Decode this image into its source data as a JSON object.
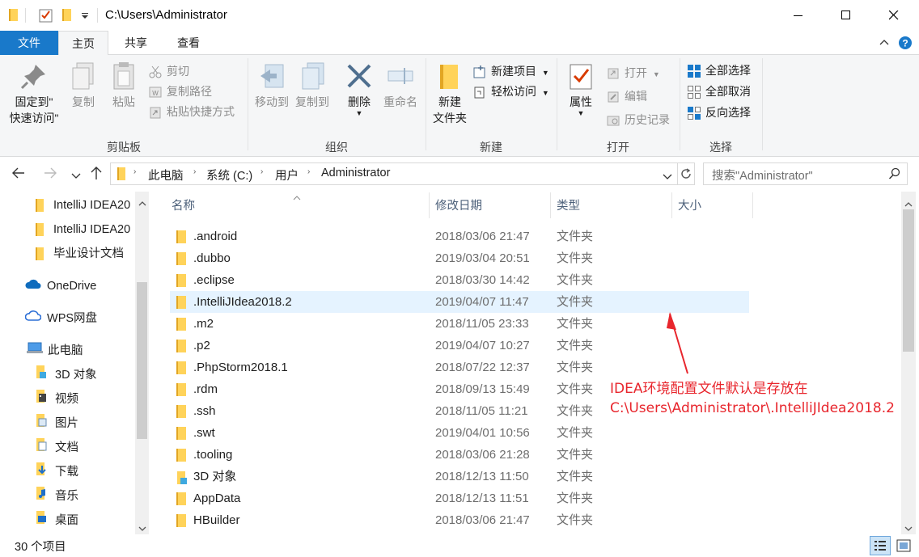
{
  "window": {
    "title": "C:\\Users\\Administrator",
    "minimize_glyph": "—",
    "maximize_glyph": "☐",
    "close_glyph": "✕"
  },
  "tabs": [
    {
      "label": "文件"
    },
    {
      "label": "主页"
    },
    {
      "label": "共享"
    },
    {
      "label": "查看"
    }
  ],
  "ribbon": {
    "clipboard": {
      "label": "剪贴板",
      "pin_line1": "固定到\"",
      "pin_line2": "快速访问\"",
      "copy": "复制",
      "paste": "粘贴",
      "cut": "剪切",
      "copy_path": "复制路径",
      "paste_shortcut": "粘贴快捷方式"
    },
    "organize": {
      "label": "组织",
      "move_to": "移动到",
      "copy_to": "复制到",
      "delete": "删除",
      "rename": "重命名"
    },
    "new": {
      "label": "新建",
      "new_folder_line1": "新建",
      "new_folder_line2": "文件夹",
      "new_item": "新建项目",
      "easy_access": "轻松访问"
    },
    "open": {
      "label": "打开",
      "properties": "属性",
      "open": "打开",
      "edit": "编辑",
      "history": "历史记录"
    },
    "select": {
      "label": "选择",
      "select_all": "全部选择",
      "select_none": "全部取消",
      "invert": "反向选择"
    }
  },
  "address": {
    "crumbs": [
      "此电脑",
      "系统 (C:)",
      "用户",
      "Administrator"
    ],
    "search_placeholder": "搜索\"Administrator\""
  },
  "nav": {
    "quick": [
      "IntelliJ IDEA20",
      "IntelliJ IDEA20",
      "毕业设计文档"
    ],
    "onedrive": "OneDrive",
    "wps": "WPS网盘",
    "thispc": "此电脑",
    "pc_items": [
      "3D 对象",
      "视频",
      "图片",
      "文档",
      "下载",
      "音乐",
      "桌面"
    ]
  },
  "columns": {
    "name": "名称",
    "date": "修改日期",
    "type": "类型",
    "size": "大小"
  },
  "files": [
    {
      "name": ".android",
      "date": "2018/03/06 21:47",
      "type": "文件夹"
    },
    {
      "name": ".dubbo",
      "date": "2019/03/04 20:51",
      "type": "文件夹"
    },
    {
      "name": ".eclipse",
      "date": "2018/03/30 14:42",
      "type": "文件夹"
    },
    {
      "name": ".IntelliJIdea2018.2",
      "date": "2019/04/07 11:47",
      "type": "文件夹"
    },
    {
      "name": ".m2",
      "date": "2018/11/05 23:33",
      "type": "文件夹"
    },
    {
      "name": ".p2",
      "date": "2019/04/07 10:27",
      "type": "文件夹"
    },
    {
      "name": ".PhpStorm2018.1",
      "date": "2018/07/22 12:37",
      "type": "文件夹"
    },
    {
      "name": ".rdm",
      "date": "2018/09/13 15:49",
      "type": "文件夹"
    },
    {
      "name": ".ssh",
      "date": "2018/11/05 11:21",
      "type": "文件夹"
    },
    {
      "name": ".swt",
      "date": "2019/04/01 10:56",
      "type": "文件夹"
    },
    {
      "name": ".tooling",
      "date": "2018/03/06 21:28",
      "type": "文件夹"
    },
    {
      "name": "3D 对象",
      "date": "2018/12/13 11:50",
      "type": "文件夹"
    },
    {
      "name": "AppData",
      "date": "2018/12/13 11:51",
      "type": "文件夹"
    },
    {
      "name": "HBuilder",
      "date": "2018/03/06 21:47",
      "type": "文件夹"
    }
  ],
  "annotation": {
    "line1": "IDEA环境配置文件默认是存放在",
    "line2": "C:\\Users\\Administrator\\.IntelliJIdea2018.2"
  },
  "status": {
    "count": "30 个项目"
  },
  "colors": {
    "accent": "#1979ca",
    "annotation": "#e8262d",
    "selected_row": "#e5f3ff"
  }
}
